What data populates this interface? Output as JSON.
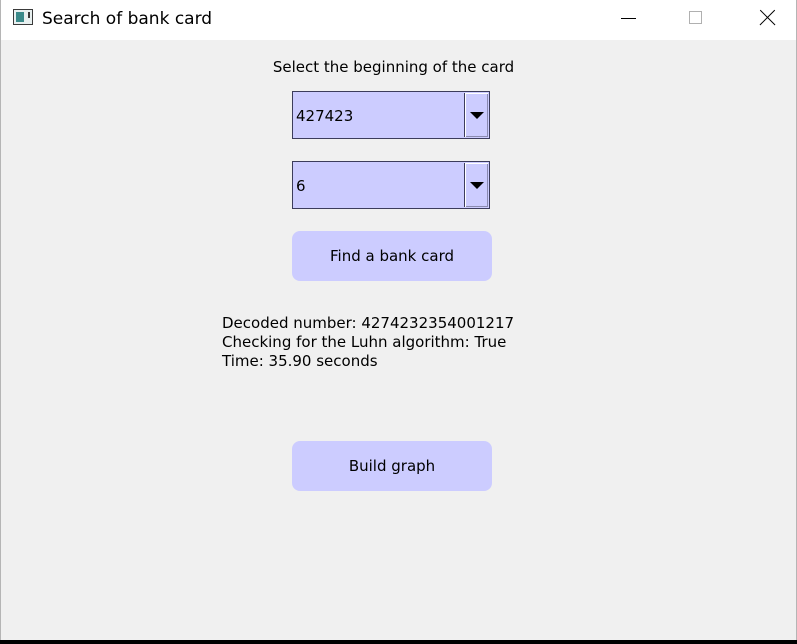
{
  "window": {
    "title": "Search of bank card",
    "icon": "app-window-icon",
    "controls": [
      "minimize-icon",
      "maximize-icon",
      "close-icon"
    ]
  },
  "form": {
    "select_label": "Select the beginning of the card",
    "card_prefix_select": {
      "selected": "427423"
    },
    "second_select": {
      "selected": "6"
    },
    "find_button_label": "Find a bank card",
    "graph_button_label": "Build graph"
  },
  "result": {
    "decoded_number": "Decoded number: 4274232354001217",
    "luhn_check": "Checking for the Luhn algorithm: True",
    "time": "Time: 35.90 seconds"
  },
  "colors": {
    "control_fill": "#ccccff",
    "window_background": "#f0f0f0",
    "titlebar_background": "#ffffff"
  }
}
